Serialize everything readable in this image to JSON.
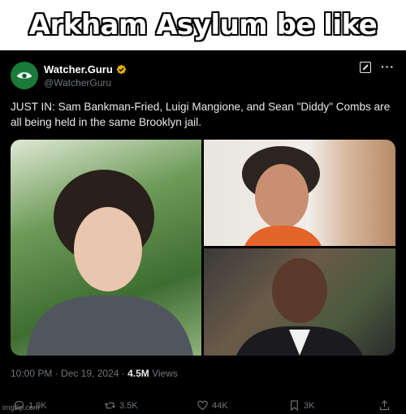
{
  "caption": "Arkham Asylum be like",
  "tweet": {
    "author_name": "Watcher.Guru",
    "handle": "@WatcherGuru",
    "text": "JUST IN: Sam Bankman-Fried, Luigi Mangione, and Sean \"Diddy\" Combs are all being held in the same Brooklyn jail.",
    "timestamp": "10:00 PM · Dec 19, 2024 · ",
    "views_count": "4.5M",
    "views_label": " Views",
    "replies": "1.9K",
    "reposts": "3.5K",
    "likes": "44K",
    "bookmarks": "3K"
  },
  "colors": {
    "avatar_bg": "#1a7a3a",
    "verified": "#e8b400",
    "accent": "#1d9bf0"
  },
  "icons": {
    "avatar": "eye-logo-icon",
    "verified": "verified-badge-icon",
    "grok": "grok-icon",
    "more": "more-icon",
    "reply": "reply-icon",
    "repost": "repost-icon",
    "like": "heart-icon",
    "bookmark": "bookmark-icon",
    "share": "share-icon"
  },
  "watermark": "imgflip.com"
}
